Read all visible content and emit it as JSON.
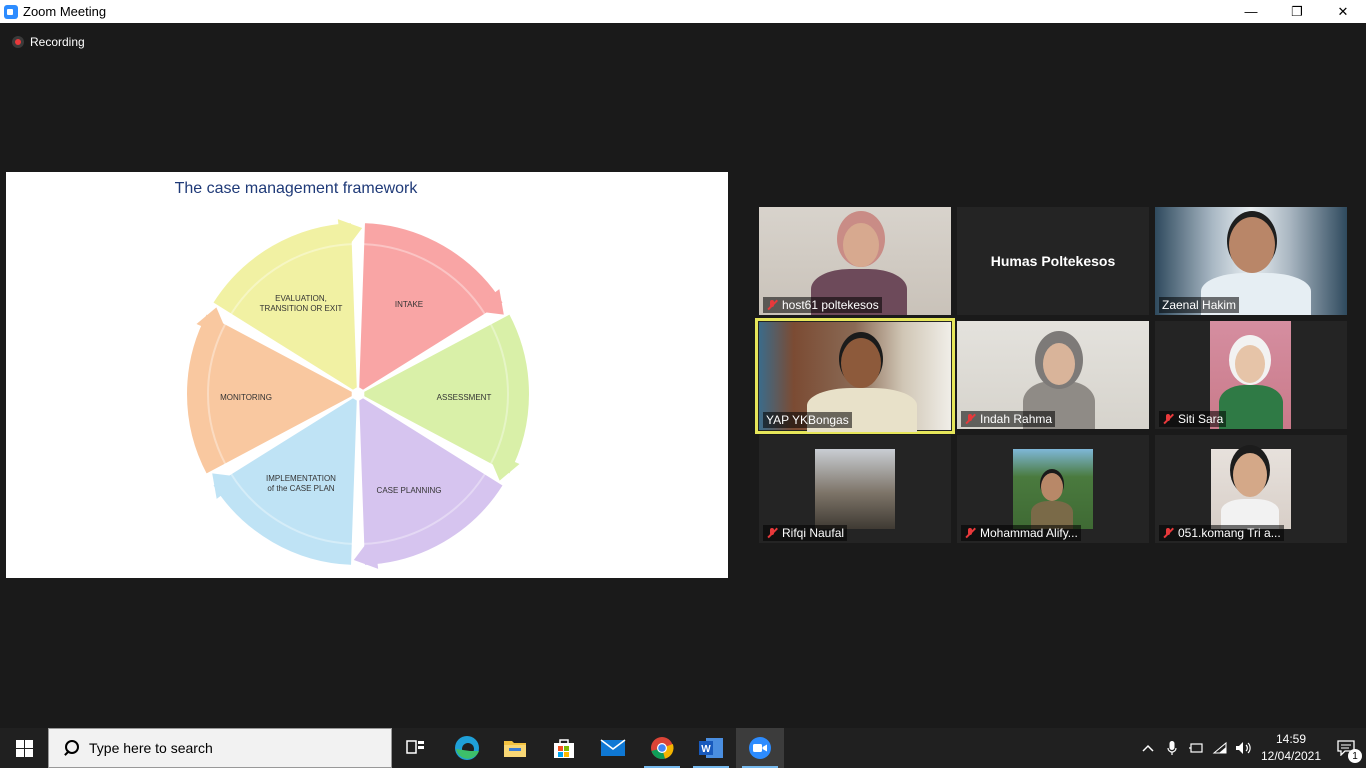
{
  "window": {
    "title": "Zoom Meeting",
    "minimize": "—",
    "restore": "❐",
    "close": "✕"
  },
  "recording": {
    "label": "Recording"
  },
  "shared_slide": {
    "title": "The case management framework",
    "segments": [
      {
        "label": "INTAKE",
        "color": "#f9a5a5"
      },
      {
        "label": "ASSESSMENT",
        "color": "#d9f0a8"
      },
      {
        "label": "CASE PLANNING",
        "color": "#d6c4ef"
      },
      {
        "label_line1": "IMPLEMENTATION",
        "label_line2": "of the CASE PLAN",
        "color": "#bfe3f5"
      },
      {
        "label": "MONITORING",
        "color": "#f9c8a0"
      },
      {
        "label_line1": "EVALUATION,",
        "label_line2": "TRANSITION OR EXIT",
        "color": "#f1f1a3"
      }
    ]
  },
  "participants": [
    {
      "name": "host61 poltekesos",
      "muted": true
    },
    {
      "name": "Humas Poltekesos",
      "muted": false
    },
    {
      "name": "Zaenal Hakim",
      "muted": false
    },
    {
      "name": "YAP YKBongas",
      "muted": false,
      "speaking": true
    },
    {
      "name": "Indah Rahma",
      "muted": true
    },
    {
      "name": "Siti Sara",
      "muted": true
    },
    {
      "name": "Rifqi Naufal",
      "muted": true
    },
    {
      "name": "Mohammad Alify...",
      "muted": true
    },
    {
      "name": "051.komang Tri a...",
      "muted": true
    }
  ],
  "taskbar": {
    "search_placeholder": "Type here to search",
    "apps": [
      "task-view",
      "edge",
      "file-explorer",
      "store",
      "mail",
      "chrome",
      "word",
      "zoom"
    ],
    "time": "14:59",
    "date": "12/04/2021",
    "notification_count": "1"
  }
}
